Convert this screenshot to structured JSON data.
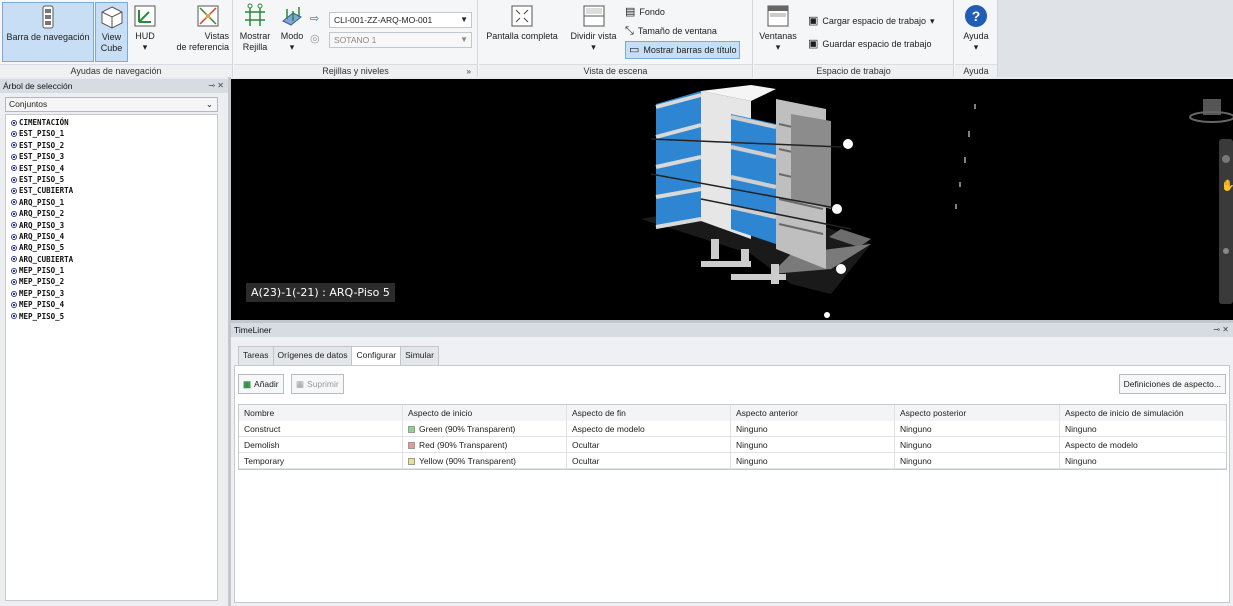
{
  "ribbon": {
    "groups": {
      "nav_aids": "Ayudas de navegación",
      "grids": "Rejillas y niveles",
      "scene_view": "Vista de escena",
      "workspace": "Espacio de trabajo",
      "help": "Ayuda"
    },
    "nav_bar": "Barra de navegación",
    "view_cube_1": "View",
    "view_cube_2": "Cube",
    "hud": "HUD",
    "ref_views_1": "Vistas",
    "ref_views_2": "de referencia",
    "show_grid_1": "Mostrar",
    "show_grid_2": "Rejilla",
    "mode": "Modo",
    "grid_combo": "CLI-001-ZZ-ARQ-MO-001",
    "level_combo": "SOTANO 1",
    "fullscreen": "Pantalla completa",
    "split_view": "Dividir vista",
    "background": "Fondo",
    "window_size": "Tamaño de ventana",
    "show_titlebars": "Mostrar barras de título",
    "windows": "Ventanas",
    "load_workspace": "Cargar espacio de trabajo",
    "save_workspace": "Guardar espacio de trabajo",
    "help": "Ayuda"
  },
  "selection_tree": {
    "title": "Árbol de selección",
    "combo": "Conjuntos",
    "items": [
      "CIMENTACIÓN",
      "EST_PISO_1",
      "EST_PISO_2",
      "EST_PISO_3",
      "EST_PISO_4",
      "EST_PISO_5",
      "EST_CUBIERTA",
      "ARQ_PISO_1",
      "ARQ_PISO_2",
      "ARQ_PISO_3",
      "ARQ_PISO_4",
      "ARQ_PISO_5",
      "ARQ_CUBIERTA",
      "MEP_PISO_1",
      "MEP_PISO_2",
      "MEP_PISO_3",
      "MEP_PISO_4",
      "MEP_PISO_5"
    ]
  },
  "viewport": {
    "label": "A(23)-1(-21) : ARQ-Piso 5"
  },
  "timeliner": {
    "title": "TimeLiner",
    "tabs": [
      "Tareas",
      "Orígenes de datos",
      "Configurar",
      "Simular"
    ],
    "add": "Añadir",
    "delete": "Suprimir",
    "definitions": "Definiciones de aspecto...",
    "columns": [
      "Nombre",
      "Aspecto de inicio",
      "Aspecto de fin",
      "Aspecto anterior",
      "Aspecto posterior",
      "Aspecto de inicio de simulación"
    ],
    "rows": [
      {
        "name": "Construct",
        "start": "Green (90% Transparent)",
        "start_color": "#8fd18f",
        "end": "Aspecto de modelo",
        "before": "Ninguno",
        "after": "Ninguno",
        "sim": "Ninguno"
      },
      {
        "name": "Demolish",
        "start": "Red (90% Transparent)",
        "start_color": "#e79a9a",
        "end": "Ocultar",
        "before": "Ninguno",
        "after": "Ninguno",
        "sim": "Aspecto de modelo"
      },
      {
        "name": "Temporary",
        "start": "Yellow (90% Transparent)",
        "start_color": "#e6e28f",
        "end": "Ocultar",
        "before": "Ninguno",
        "after": "Ninguno",
        "sim": "Ninguno"
      }
    ]
  }
}
